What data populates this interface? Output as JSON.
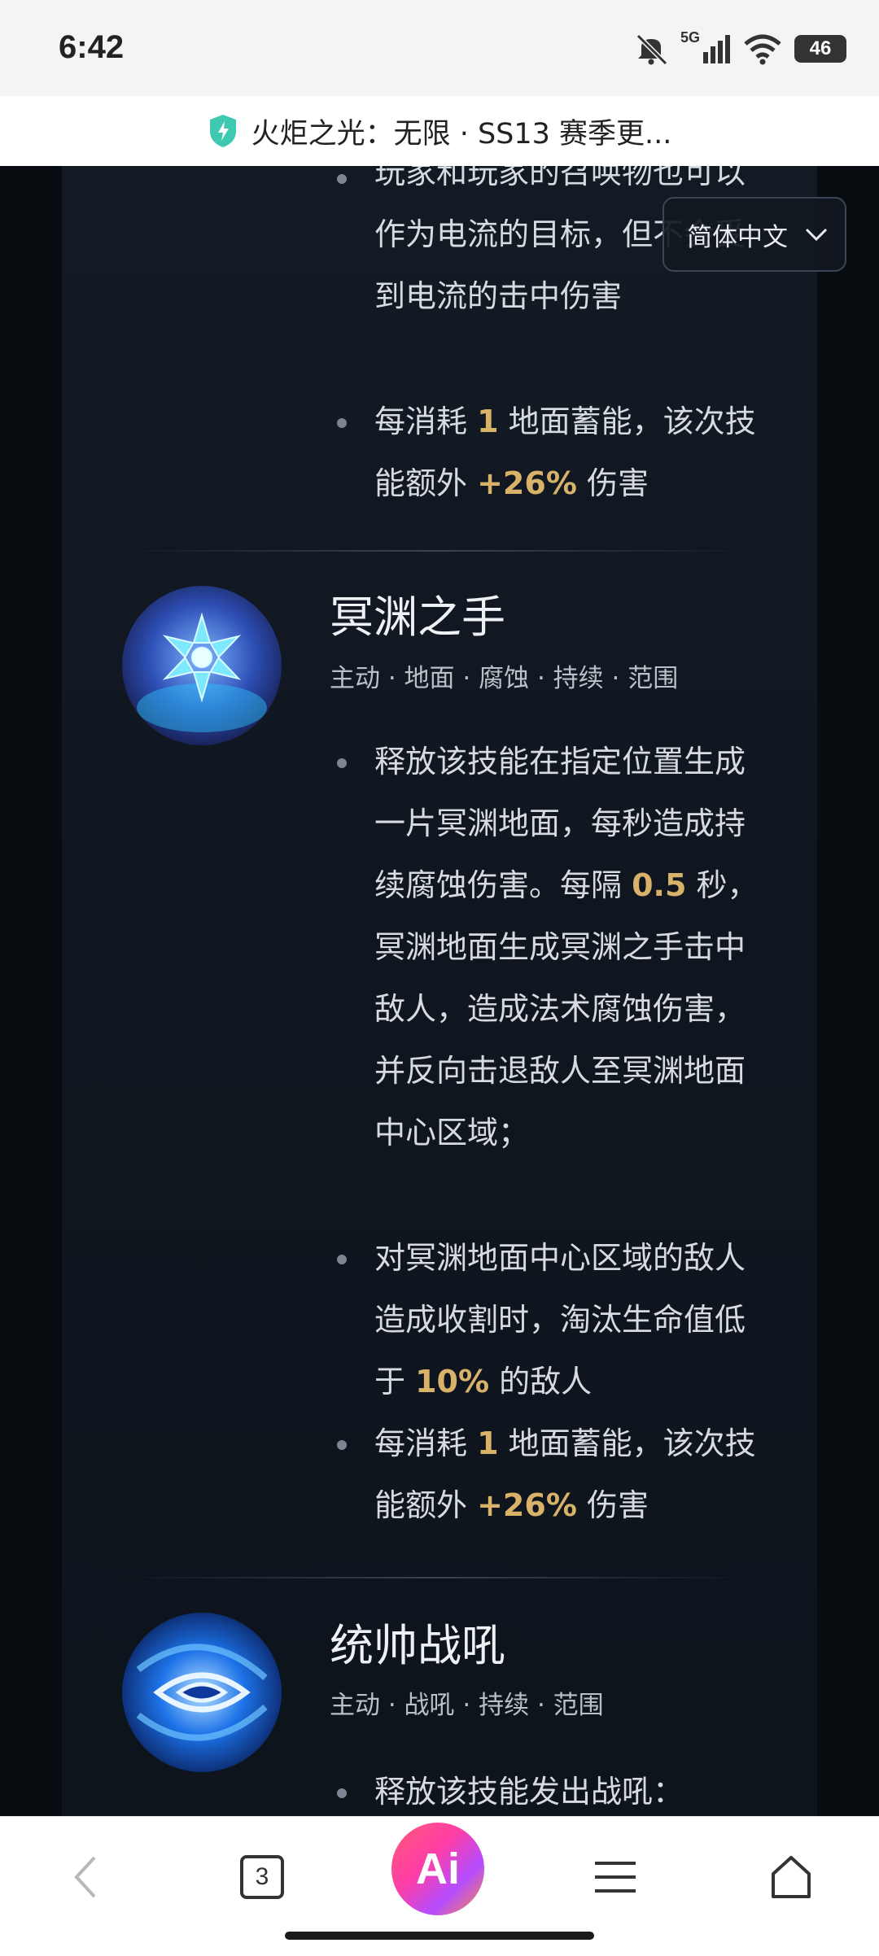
{
  "status_bar": {
    "time": "6:42",
    "network": "5G",
    "battery": "46"
  },
  "browser": {
    "page_title": "火炬之光：无限 · SS13 赛季更...",
    "tab_count": "3",
    "ai_label": "Ai"
  },
  "language_select": {
    "selected": "简体中文"
  },
  "top_skill": {
    "bullets": [
      "玩家和玩家的召唤物也可以作为电流的目标，但不会受到电流的击中伤害"
    ],
    "energy_bullet": {
      "pre": "每消耗 ",
      "n1": "1",
      "mid": " 地面蓄能，该次技能额外 ",
      "n2": "+26%",
      "post": " 伤害"
    }
  },
  "skills": [
    {
      "name": "冥渊之手",
      "tags": "主动 · 地面 · 腐蚀 · 持续 · 范围",
      "b1": {
        "pre": "释放该技能在指定位置生成一片冥渊地面，每秒造成持续腐蚀伤害。每隔 ",
        "num": "0.5",
        "post": " 秒，冥渊地面生成冥渊之手击中敌人，造成法术腐蚀伤害，并反向击退敌人至冥渊地面中心区域；"
      },
      "b2": {
        "pre": "对冥渊地面中心区域的敌人造成收割时，淘汰生命值低于 ",
        "num": "10%",
        "post": " 的敌人"
      },
      "b3": {
        "pre": "每消耗 ",
        "n1": "1",
        "mid": " 地面蓄能，该次技能额外 ",
        "n2": "+26%",
        "post": " 伤害"
      }
    },
    {
      "name": "统帅战吼",
      "tags": "主动 · 战吼 · 持续 · 范围",
      "b1": {
        "text": "释放该技能发出战吼："
      }
    }
  ],
  "colors": {
    "highlight": "#d9b26a",
    "panel": "#121a24",
    "text": "#d7dbe0"
  }
}
